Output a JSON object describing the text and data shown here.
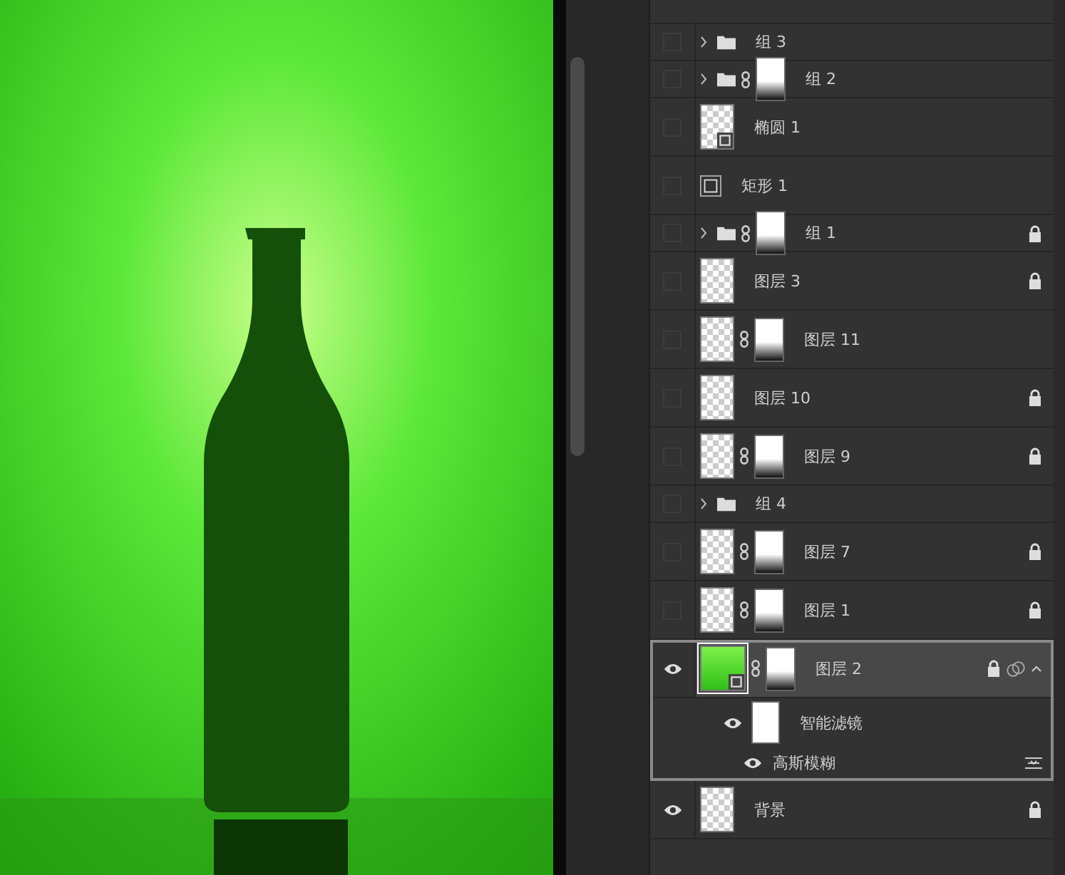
{
  "layers": [
    {
      "kind": "group",
      "name": "组 3",
      "visible": false,
      "locked": false,
      "selected": false,
      "mask": false
    },
    {
      "kind": "group",
      "name": "组 2",
      "visible": false,
      "locked": false,
      "selected": false,
      "mask": true
    },
    {
      "kind": "shape",
      "name": "椭圆 1",
      "visible": false,
      "locked": false,
      "selected": false,
      "mask": false
    },
    {
      "kind": "vector",
      "name": "矩形 1",
      "visible": false,
      "locked": false,
      "selected": false,
      "mask": false
    },
    {
      "kind": "group",
      "name": "组 1",
      "visible": false,
      "locked": true,
      "selected": false,
      "mask": true
    },
    {
      "kind": "layer",
      "name": "图层 3",
      "visible": false,
      "locked": true,
      "selected": false,
      "mask": false
    },
    {
      "kind": "layer",
      "name": "图层 11",
      "visible": false,
      "locked": false,
      "selected": false,
      "mask": true
    },
    {
      "kind": "layer",
      "name": "图层 10",
      "visible": false,
      "locked": true,
      "selected": false,
      "mask": false
    },
    {
      "kind": "layer",
      "name": "图层 9",
      "visible": false,
      "locked": true,
      "selected": false,
      "mask": true
    },
    {
      "kind": "group",
      "name": "组 4",
      "visible": false,
      "locked": false,
      "selected": false,
      "mask": false
    },
    {
      "kind": "layer",
      "name": "图层 7",
      "visible": false,
      "locked": true,
      "selected": false,
      "mask": true
    },
    {
      "kind": "layer",
      "name": "图层 1",
      "visible": false,
      "locked": true,
      "selected": false,
      "mask": true
    },
    {
      "kind": "smart",
      "name": "图层 2",
      "visible": true,
      "locked": true,
      "selected": true,
      "mask": true,
      "expanded": true,
      "filters": {
        "label": "智能滤镜",
        "visible": true,
        "items": [
          {
            "label": "高斯模糊",
            "visible": true
          }
        ]
      }
    },
    {
      "kind": "layer",
      "name": "背景",
      "visible": true,
      "locked": true,
      "selected": false,
      "mask": false
    }
  ]
}
